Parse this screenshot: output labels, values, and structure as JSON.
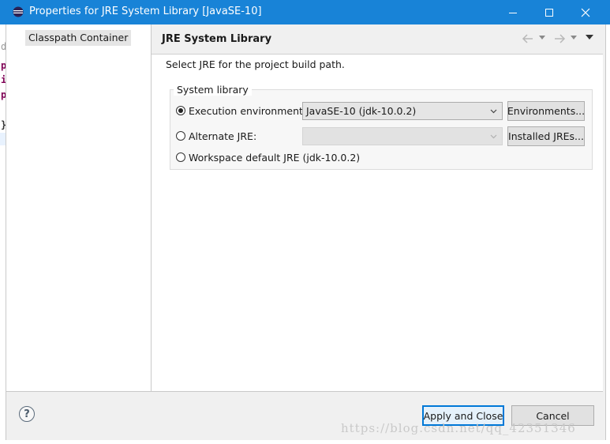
{
  "window": {
    "title": "Properties for JRE System Library [JavaSE-10]",
    "controls": [
      "minimize-icon",
      "maximize-icon",
      "close-icon"
    ]
  },
  "background_editor_chars": [
    "d",
    "p",
    "i",
    "p",
    "}"
  ],
  "nav": {
    "items": [
      {
        "label": "Classpath Container",
        "selected": true
      }
    ]
  },
  "page": {
    "title": "JRE System Library",
    "header_icons": [
      "back-arrow-icon",
      "back-dropdown-icon",
      "forward-arrow-icon",
      "forward-dropdown-icon",
      "view-menu-icon"
    ],
    "description": "Select JRE for the project build path.",
    "group": {
      "label": "System library",
      "options": [
        {
          "label": "Execution environment:",
          "checked": true,
          "combo_value": "JavaSE-10 (jdk-10.0.2)",
          "combo_enabled": true,
          "button": "Environments..."
        },
        {
          "label": "Alternate JRE:",
          "checked": false,
          "combo_value": "",
          "combo_enabled": false,
          "button": "Installed JREs..."
        },
        {
          "label": "Workspace default JRE (jdk-10.0.2)",
          "checked": false
        }
      ]
    }
  },
  "footer": {
    "help_glyph": "?",
    "apply_close_label": "Apply and Close",
    "cancel_label": "Cancel"
  },
  "watermark": "https://blog.csdn.net/qq_42351346",
  "colors": {
    "titlebar": "#1883d7",
    "dialog_bg": "#f0f0f0",
    "default_button_border": "#0078d7",
    "keyword_purple": "#7f0055"
  }
}
